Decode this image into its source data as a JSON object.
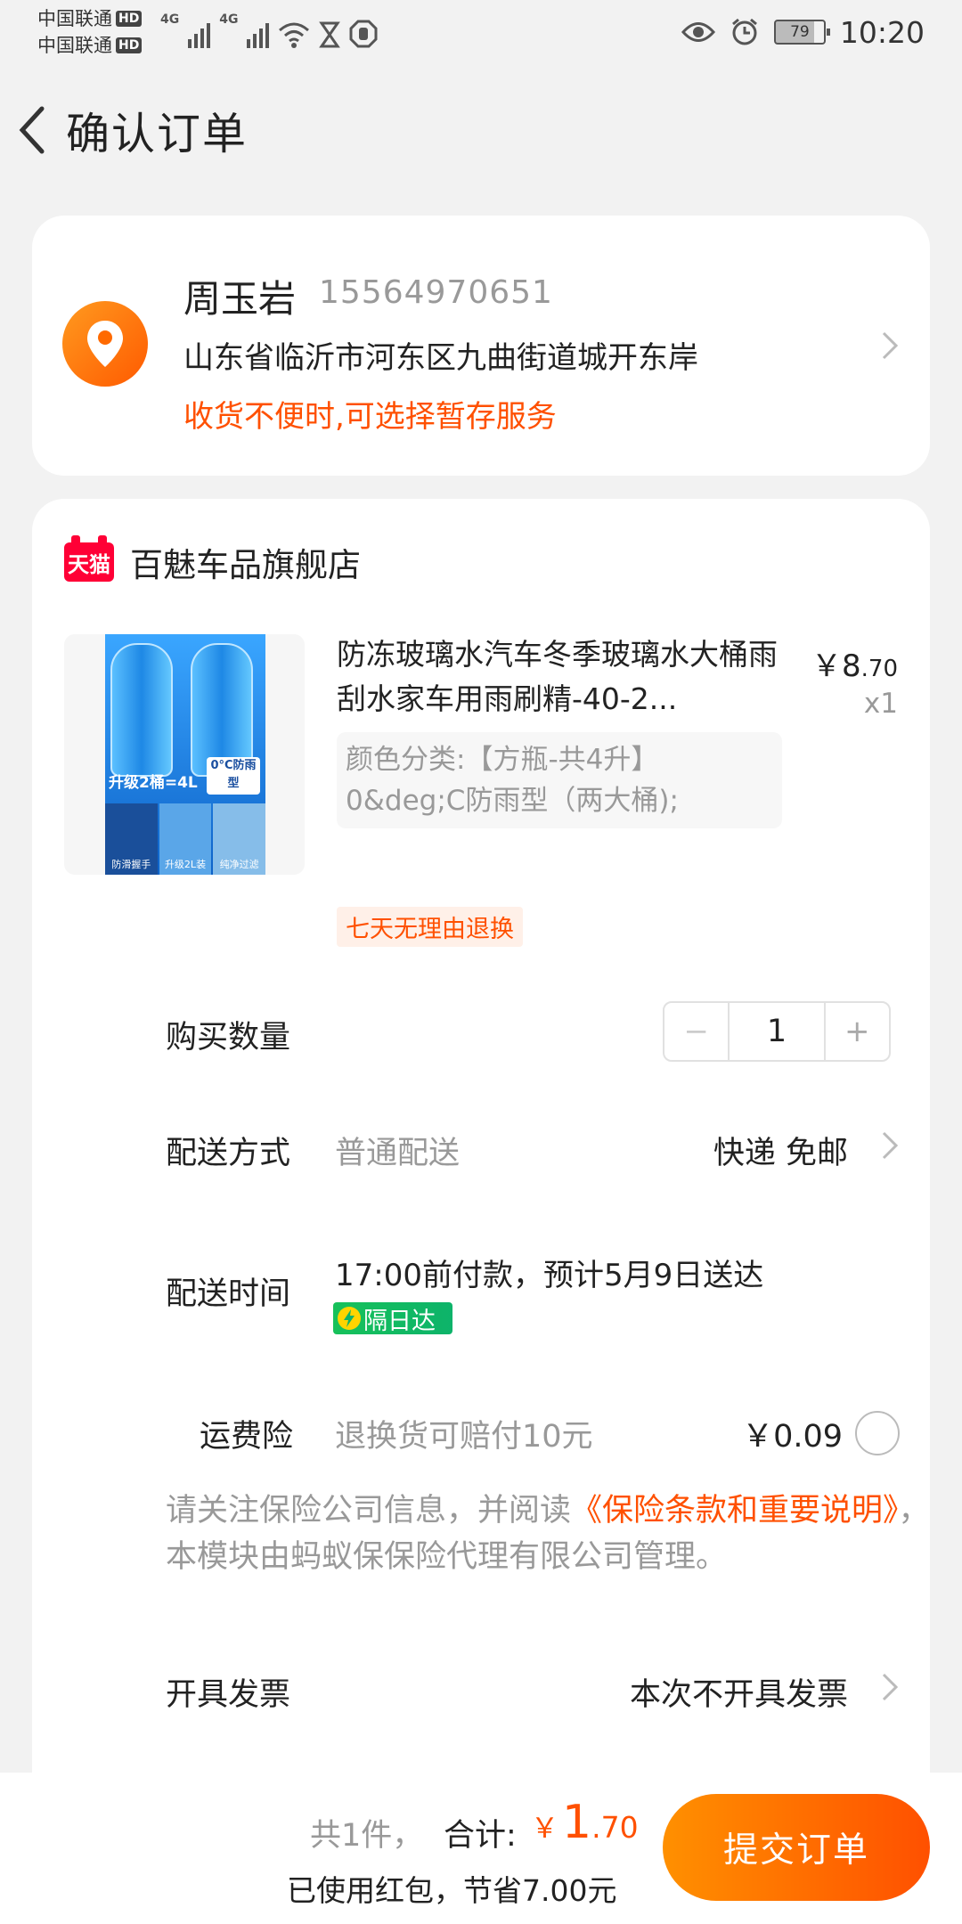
{
  "status_bar": {
    "carrier1": "中国联通",
    "carrier2": "中国联通",
    "hd": "HD",
    "network": "4G",
    "battery": "79",
    "time": "10:20"
  },
  "header": {
    "title": "确认订单"
  },
  "address": {
    "name": "周玉岩",
    "phone": "15564970651",
    "detail": "山东省临沂市河东区九曲街道城开东岸",
    "hint": "收货不便时,可选择暂存服务",
    "accent": "#ff5000"
  },
  "shop": {
    "badge": "天猫",
    "name": "百魅车品旗舰店"
  },
  "product": {
    "title": "防冻玻璃水汽车冬季玻璃水大桶雨刮水家车用雨刷精-40-2...",
    "price_symbol": "￥",
    "price_int": "8",
    "price_dec": ".70",
    "qty": "x1",
    "sku": "颜色分类:【方瓶-共4升】0&deg;C防雨型（两大桶);",
    "image_tag_upgrade": "升级2桶=4L",
    "image_tag_temp": "0°C防雨型",
    "image_strip": [
      "防滑握手",
      "升级2L装",
      "纯净过滤"
    ],
    "return_policy": "七天无理由退换"
  },
  "quantity": {
    "label": "购买数量",
    "minus": "−",
    "value": "1",
    "plus": "+"
  },
  "shipping": {
    "label": "配送方式",
    "method": "普通配送",
    "value": "快递 免邮"
  },
  "delivery_time": {
    "label": "配送时间",
    "value": "17:00前付款，预计5月9日送达",
    "badge": "隔日达"
  },
  "insurance": {
    "label": "运费险",
    "desc": "退换货可赔付10元",
    "price": "￥0.09",
    "notice_prefix": "请关注保险公司信息，并阅读",
    "notice_link": "《保险条款和重要说明》",
    "notice_suffix": "，本模块由蚂蚁保保险代理有限公司管理。"
  },
  "invoice": {
    "label": "开具发票",
    "value": "本次不开具发票"
  },
  "bottom_bar": {
    "count": "共1件，",
    "total_label": "合计:",
    "total_symbol": "￥",
    "total_int": "1",
    "total_dec": ".70",
    "savings": "已使用红包，节省7.00元",
    "submit": "提交订单"
  }
}
